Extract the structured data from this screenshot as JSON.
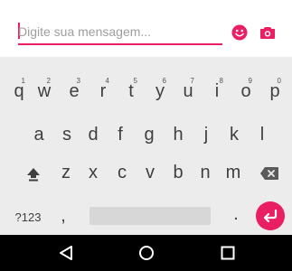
{
  "compose": {
    "placeholder": "Digite sua mensagem...",
    "value": "",
    "emoji_icon": "emoji-icon",
    "camera_icon": "camera-icon",
    "accent_color": "#e91e63"
  },
  "keyboard": {
    "row1": [
      {
        "label": "q",
        "hint": "1"
      },
      {
        "label": "w",
        "hint": "2"
      },
      {
        "label": "e",
        "hint": "3"
      },
      {
        "label": "r",
        "hint": "4"
      },
      {
        "label": "t",
        "hint": "5"
      },
      {
        "label": "y",
        "hint": "6"
      },
      {
        "label": "u",
        "hint": "7"
      },
      {
        "label": "i",
        "hint": "8"
      },
      {
        "label": "o",
        "hint": "9"
      },
      {
        "label": "p",
        "hint": "0"
      }
    ],
    "row2": [
      "a",
      "s",
      "d",
      "f",
      "g",
      "h",
      "j",
      "k",
      "l"
    ],
    "row3": [
      "z",
      "x",
      "c",
      "v",
      "b",
      "n",
      "m"
    ],
    "symbols_label": "?123",
    "comma_label": ",",
    "period_label": ".",
    "shift_icon": "shift-icon",
    "backspace_icon": "backspace-icon",
    "enter_icon": "enter-icon"
  },
  "navbar": {
    "back_icon": "back-triangle-icon",
    "home_icon": "home-circle-icon",
    "recents_icon": "recents-square-icon"
  }
}
